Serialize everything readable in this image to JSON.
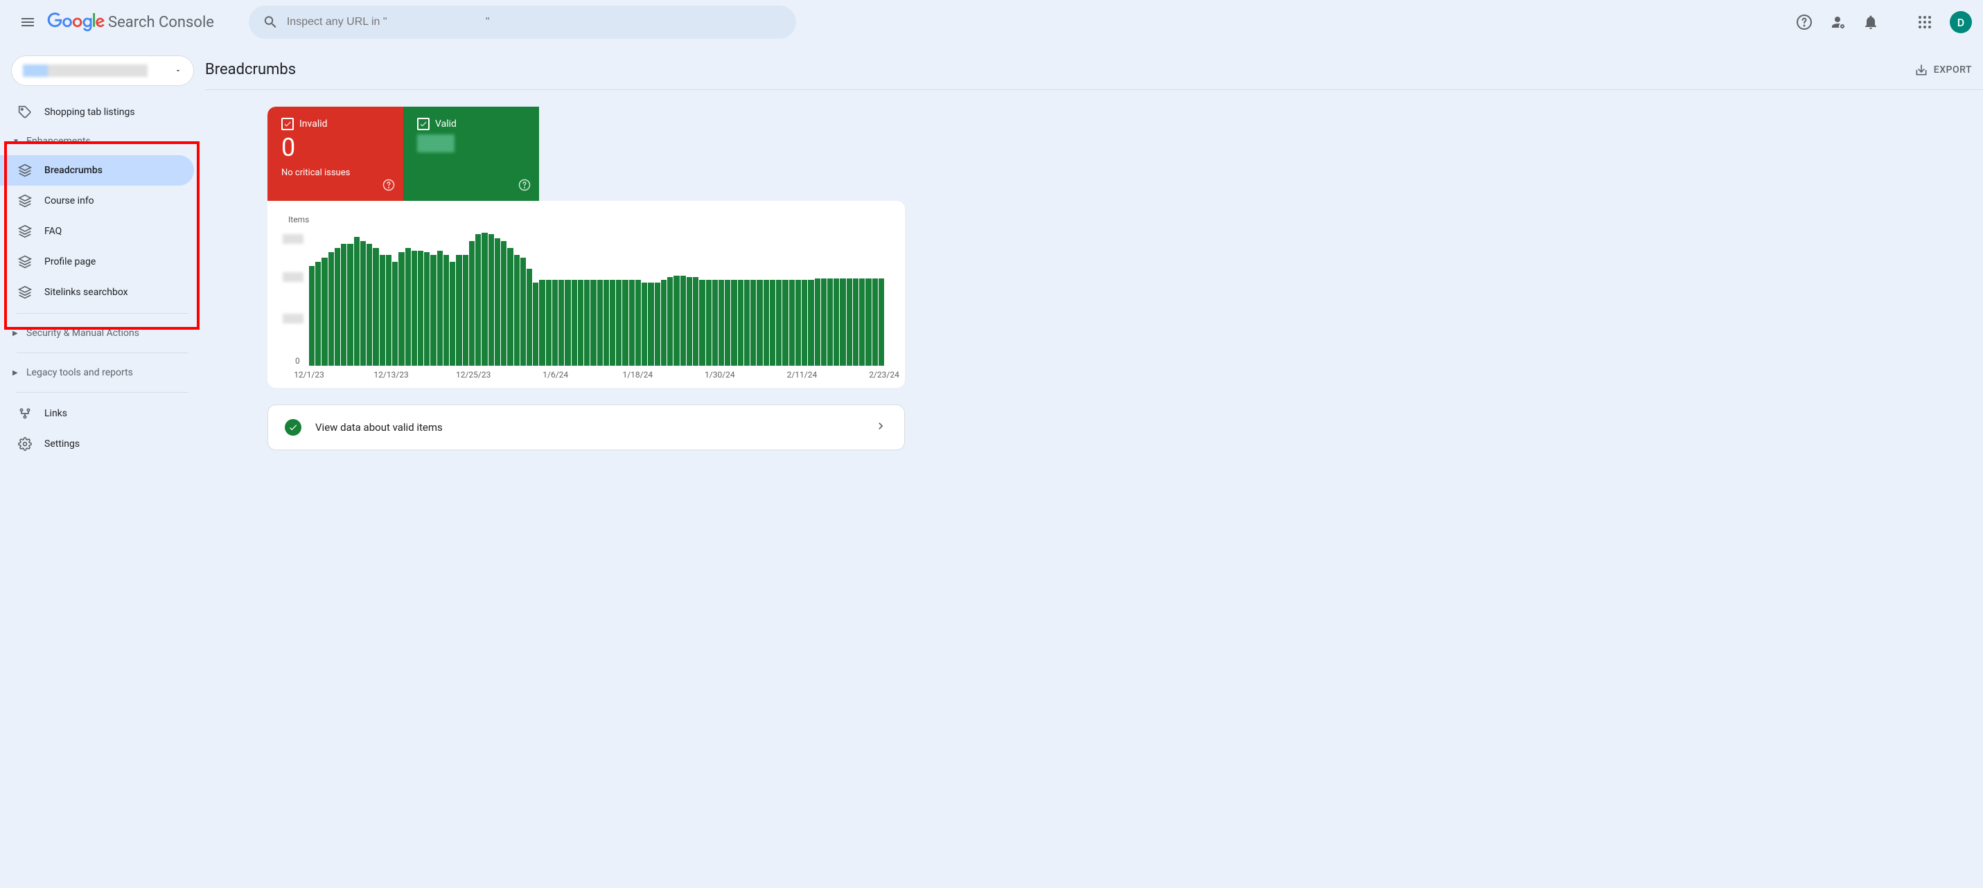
{
  "header": {
    "product_name": "Search Console",
    "search_placeholder": "Inspect any URL in \"                                \"",
    "avatar_initial": "D"
  },
  "sidebar": {
    "items": {
      "shopping": "Shopping tab listings",
      "enhancements": "Enhancements",
      "breadcrumbs": "Breadcrumbs",
      "course_info": "Course info",
      "faq": "FAQ",
      "profile_page": "Profile page",
      "sitelinks": "Sitelinks searchbox",
      "security": "Security & Manual Actions",
      "legacy": "Legacy tools and reports",
      "links": "Links",
      "settings": "Settings"
    }
  },
  "page": {
    "title": "Breadcrumbs",
    "export_label": "EXPORT"
  },
  "status": {
    "invalid": {
      "label": "Invalid",
      "value": "0",
      "sub": "No critical issues"
    },
    "valid": {
      "label": "Valid"
    }
  },
  "chart_data": {
    "type": "bar",
    "title": "Items",
    "ylabel": "Items",
    "ylim": [
      0,
      100
    ],
    "x_ticks": [
      "12/1/23",
      "12/13/23",
      "12/25/23",
      "1/6/24",
      "1/18/24",
      "1/30/24",
      "2/11/24",
      "2/23/24"
    ],
    "series": [
      {
        "name": "Valid",
        "color": "#188038",
        "values": [
          72,
          75,
          78,
          82,
          85,
          88,
          88,
          93,
          90,
          88,
          85,
          80,
          80,
          75,
          82,
          85,
          83,
          83,
          82,
          80,
          83,
          80,
          75,
          80,
          80,
          90,
          95,
          96,
          95,
          92,
          90,
          85,
          80,
          78,
          70,
          60,
          62,
          62,
          62,
          62,
          62,
          62,
          62,
          62,
          62,
          62,
          62,
          62,
          62,
          62,
          62,
          62,
          60,
          60,
          60,
          62,
          64,
          65,
          65,
          64,
          64,
          62,
          62,
          62,
          62,
          62,
          62,
          62,
          62,
          62,
          62,
          62,
          62,
          62,
          62,
          62,
          62,
          62,
          62,
          63,
          63,
          63,
          63,
          63,
          63,
          63,
          63,
          63,
          63,
          63
        ]
      }
    ]
  },
  "link_card": {
    "text": "View data about valid items"
  }
}
